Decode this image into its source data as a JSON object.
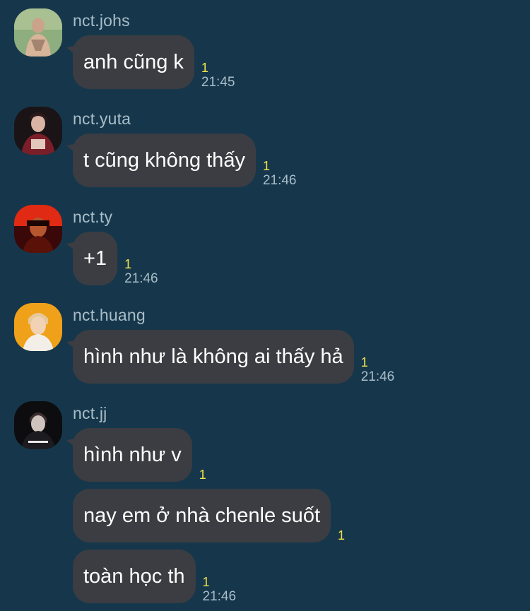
{
  "messages": [
    {
      "user": "nct.johs",
      "avatar_icon": "avatar-johs",
      "bubbles": [
        {
          "text": "anh cũng k",
          "unread": "1",
          "time": "21:45"
        }
      ]
    },
    {
      "user": "nct.yuta",
      "avatar_icon": "avatar-yuta",
      "bubbles": [
        {
          "text": "t cũng không thấy",
          "unread": "1",
          "time": "21:46"
        }
      ]
    },
    {
      "user": "nct.ty",
      "avatar_icon": "avatar-ty",
      "bubbles": [
        {
          "text": "+1",
          "unread": "1",
          "time": "21:46"
        }
      ]
    },
    {
      "user": "nct.huang",
      "avatar_icon": "avatar-huang",
      "bubbles": [
        {
          "text": "hình như là không ai thấy hả",
          "unread": "1",
          "time": "21:46"
        }
      ]
    },
    {
      "user": "nct.jj",
      "avatar_icon": "avatar-jj",
      "bubbles": [
        {
          "text": "hình như v",
          "unread": "1",
          "time": ""
        },
        {
          "text": "nay em ở nhà chenle suốt",
          "unread": "1",
          "time": ""
        },
        {
          "text": "toàn học th",
          "unread": "1",
          "time": "21:46"
        }
      ]
    }
  ],
  "colors": {
    "background": "#16374b",
    "bubble": "#3b3d42",
    "unread": "#f3e34a",
    "muted_text": "#a9bdc8"
  }
}
